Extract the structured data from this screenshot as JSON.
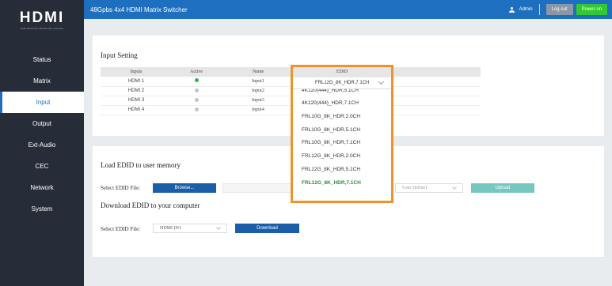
{
  "header": {
    "title": "48Gpbs 4x4 HDMI Matrix Switcher",
    "user": "Admin",
    "logout_label": "Log out",
    "power_label": "Power on"
  },
  "logo": {
    "text": "HDMI",
    "subtitle": "High-Definition Multimedia Interface"
  },
  "sidebar": {
    "items": [
      {
        "label": "Status"
      },
      {
        "label": "Matrix"
      },
      {
        "label": "Input"
      },
      {
        "label": "Output"
      },
      {
        "label": "Ext-Audio"
      },
      {
        "label": "CEC"
      },
      {
        "label": "Network"
      },
      {
        "label": "System"
      }
    ],
    "active": "Input"
  },
  "input_setting": {
    "title": "Input Setting",
    "columns": [
      "Inputs",
      "Active",
      "Name",
      "EDID"
    ],
    "rows": [
      {
        "input": "HDMI 1",
        "active": true,
        "name": "Input1"
      },
      {
        "input": "HDMI 2",
        "active": false,
        "name": "Input2"
      },
      {
        "input": "HDMI 3",
        "active": false,
        "name": "Input3"
      },
      {
        "input": "HDMI 4",
        "active": false,
        "name": "Input4"
      }
    ]
  },
  "edid_dropdown": {
    "header": "EDID",
    "selected": "FRL12G_8K_HDR,7.1CH",
    "options": [
      "4K120(444)_HDR,5.1CH",
      "4K120(444)_HDR,7.1CH",
      "FRL10G_8K_HDR,2.0CH",
      "FRL10G_8K_HDR,5.1CH",
      "FRL10G_8K_HDR,7.1CH",
      "FRL12G_8K_HDR,2.0CH",
      "FRL12G_8K_HDR,5.1CH",
      "FRL12G_8K_HDR,7.1CH"
    ]
  },
  "load_edid": {
    "title": "Load EDID to user memory",
    "select_label": "Select EDID File:",
    "browse_label": "Browse...",
    "user_define": "User Define1",
    "upload_label": "Upload"
  },
  "download_edid": {
    "title": "Download EDID to your computer",
    "select_label": "Select EDID File:",
    "source_value": "HDMI IN1",
    "download_label": "Download"
  },
  "colors": {
    "header_blue": "#1e6fbf",
    "sidebar_dark": "#272d38",
    "dropdown_highlight": "#f0922b",
    "active_dot": "#2fb34a",
    "inactive_dot": "#c4c4c4",
    "power_green": "#32c832"
  }
}
